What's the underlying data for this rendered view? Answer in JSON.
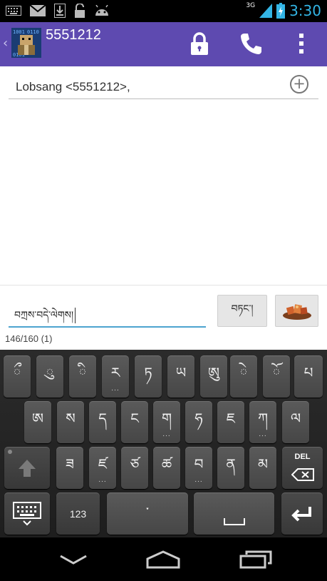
{
  "status_bar": {
    "network": "3G",
    "time": "3:30",
    "icons": [
      "keyboard-icon",
      "mail-icon",
      "download-icon",
      "lock-icon",
      "android-icon"
    ]
  },
  "action_bar": {
    "title": "5551212",
    "actions": [
      "lock-icon",
      "phone-icon",
      "overflow-menu-icon"
    ],
    "color": "#5e4ab0"
  },
  "recipient": {
    "value": "Lobsang <5551212>,"
  },
  "compose": {
    "message": "བཀྲས་བདེ་ལེགས།",
    "send_label": "བཏང་།",
    "counter": "146/160 (1)"
  },
  "keyboard": {
    "row1": [
      {
        "label": "ྀ",
        "dots": ""
      },
      {
        "label": "ུ",
        "dots": ""
      },
      {
        "label": "ི",
        "dots": ""
      },
      {
        "label": "ར",
        "dots": "..."
      },
      {
        "label": "ཏ",
        "dots": ""
      },
      {
        "label": "ཡ",
        "dots": ""
      },
      {
        "label": "ཨུ",
        "dots": ""
      },
      {
        "label": "ེ",
        "dots": ""
      },
      {
        "label": "ོ",
        "dots": ""
      },
      {
        "label": "པ",
        "dots": ""
      }
    ],
    "row2": [
      {
        "label": "ཨ",
        "dots": ""
      },
      {
        "label": "ས",
        "dots": ""
      },
      {
        "label": "ད",
        "dots": ""
      },
      {
        "label": "ང",
        "dots": ""
      },
      {
        "label": "ག",
        "dots": "..."
      },
      {
        "label": "ཧ",
        "dots": ""
      },
      {
        "label": "ཇ",
        "dots": ""
      },
      {
        "label": "ཀ",
        "dots": "..."
      },
      {
        "label": "ལ",
        "dots": ""
      }
    ],
    "row3": [
      {
        "label": "ཟ",
        "dots": ""
      },
      {
        "label": "ཛ",
        "dots": "..."
      },
      {
        "label": "ཙ",
        "dots": ""
      },
      {
        "label": "ཚ",
        "dots": ""
      },
      {
        "label": "བ",
        "dots": "..."
      },
      {
        "label": "ན",
        "dots": ""
      },
      {
        "label": "མ",
        "dots": ""
      }
    ],
    "shift_icon": "shift-arrow-icon",
    "del_label": "DEL",
    "numbers_label": "123",
    "space_hint": "་"
  },
  "nav_bar": {
    "buttons": [
      "back-icon",
      "home-icon",
      "recent-apps-icon"
    ]
  }
}
